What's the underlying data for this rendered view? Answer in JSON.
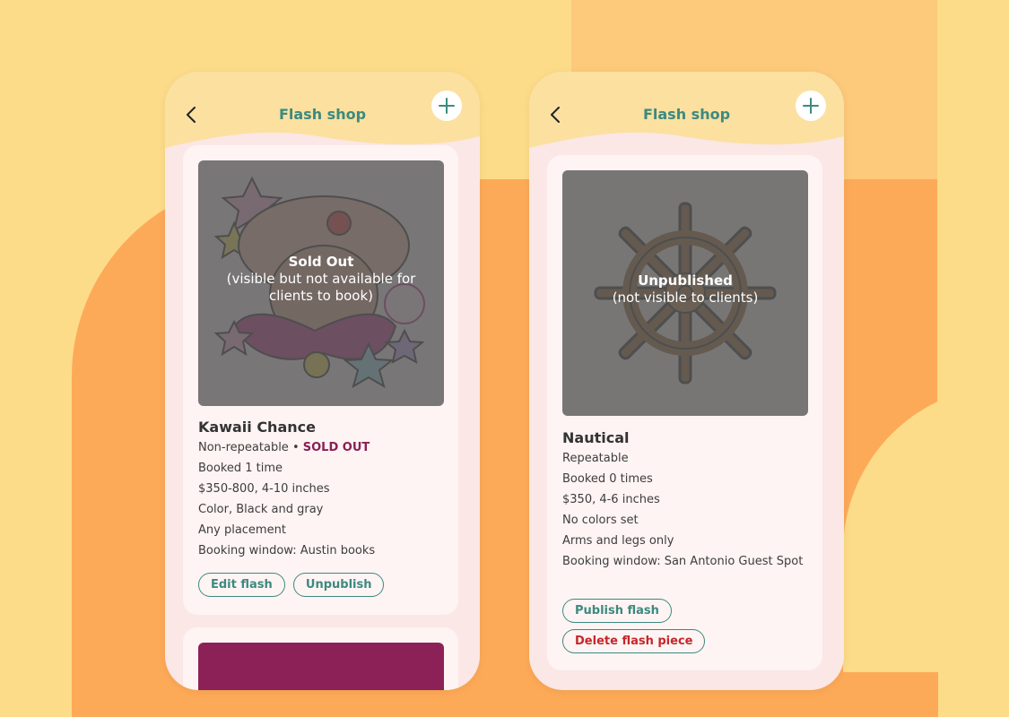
{
  "colors": {
    "accent": "#3c8a7f",
    "sold_out": "#8a1f55",
    "danger": "#c4272b",
    "header_bg": "#fbe0a0",
    "phone_bg": "#fbe7e5"
  },
  "left_screen": {
    "header": {
      "title": "Flash shop",
      "back_icon": "chevron-left-icon",
      "add_icon": "plus-icon"
    },
    "card": {
      "overlay_title": "Sold Out",
      "overlay_subtitle": "(visible but not available for clients to book)",
      "name": "Kawaii Chance",
      "repeat": "Non-repeatable",
      "separator": "•",
      "status": "SOLD OUT",
      "booked": "Booked 1 time",
      "price_size": "$350-800, 4-10 inches",
      "colors": "Color, Black and gray",
      "placement": "Any placement",
      "booking_window": "Booking window: Austin books",
      "buttons": {
        "edit": "Edit flash",
        "unpublish": "Unpublish"
      }
    }
  },
  "right_screen": {
    "header": {
      "title": "Flash shop",
      "back_icon": "chevron-left-icon",
      "add_icon": "plus-icon"
    },
    "card": {
      "overlay_title": "Unpublished",
      "overlay_subtitle": "(not visible to clients)",
      "name": "Nautical",
      "repeat": "Repeatable",
      "booked": "Booked 0 times",
      "price_size": "$350, 4-6 inches",
      "colors": "No colors set",
      "placement": "Arms and legs only",
      "booking_window": "Booking window: San Antonio Guest Spot",
      "buttons": {
        "publish": "Publish flash",
        "delete": "Delete flash piece"
      }
    }
  }
}
